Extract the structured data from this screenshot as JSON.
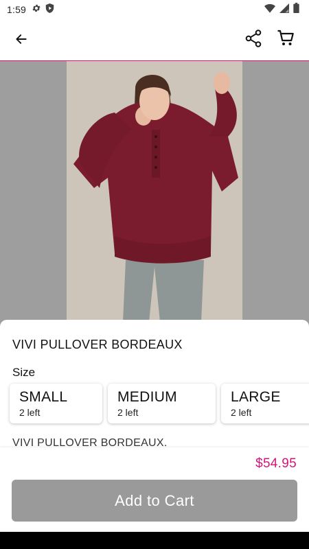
{
  "status_bar": {
    "time": "1:59",
    "left_icons": [
      "gear-icon",
      "play-protect-icon"
    ],
    "right_icons": [
      "wifi-icon",
      "signal-icon",
      "battery-icon"
    ]
  },
  "app_bar": {
    "icons": [
      "back-arrow-icon",
      "share-icon",
      "cart-icon"
    ],
    "accent_color": "#d4147a"
  },
  "product": {
    "title": "VIVI PULLOVER BORDEAUX",
    "description": "VIVI PULLOVER BORDEAUX.",
    "price": "$54.95",
    "size_label": "Size",
    "sizes": [
      {
        "name": "SMALL",
        "stock": "2 left"
      },
      {
        "name": "MEDIUM",
        "stock": "2 left"
      },
      {
        "name": "LARGE",
        "stock": "2 left"
      }
    ]
  },
  "actions": {
    "add_to_cart_label": "Add to Cart",
    "add_to_cart_color": "#9a9a9a"
  }
}
